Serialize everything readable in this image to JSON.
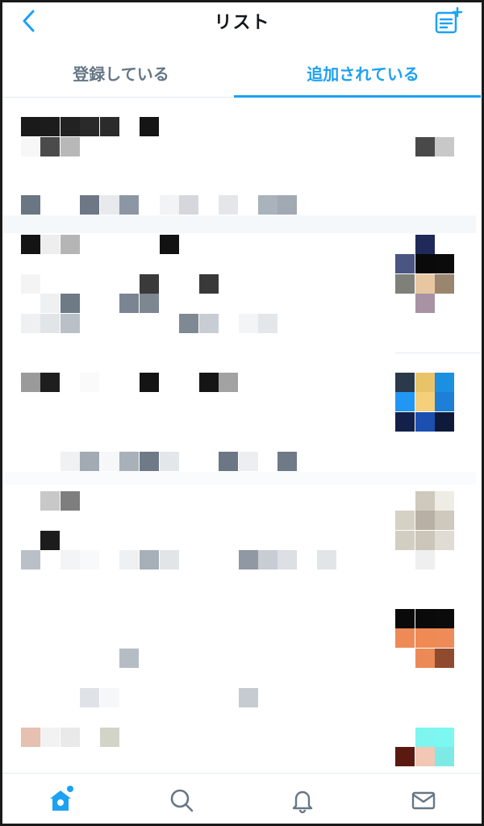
{
  "header": {
    "title": "リスト",
    "back_icon": "chevron-left-icon",
    "compose_icon": "new-list-icon"
  },
  "tabs": [
    {
      "label": "登録している",
      "active": false
    },
    {
      "label": "追加されている",
      "active": true
    }
  ],
  "colors": {
    "accent": "#1da1f2",
    "text": "#14171a",
    "muted": "#657786",
    "separator": "#f5f8fa"
  },
  "list_items": [
    {
      "name": "list-item-1",
      "content": "pixelated"
    },
    {
      "name": "list-item-2",
      "content": "pixelated"
    },
    {
      "name": "list-item-3",
      "content": "pixelated"
    },
    {
      "name": "list-item-4",
      "content": "pixelated"
    },
    {
      "name": "list-item-5",
      "content": "pixelated"
    },
    {
      "name": "list-item-6",
      "content": "pixelated"
    }
  ],
  "bottom_nav": [
    {
      "name": "home",
      "icon": "home-icon",
      "active": true,
      "has_badge_dot": true
    },
    {
      "name": "search",
      "icon": "search-icon",
      "active": false
    },
    {
      "name": "notifications",
      "icon": "bell-icon",
      "active": false
    },
    {
      "name": "messages",
      "icon": "mail-icon",
      "active": false
    }
  ]
}
